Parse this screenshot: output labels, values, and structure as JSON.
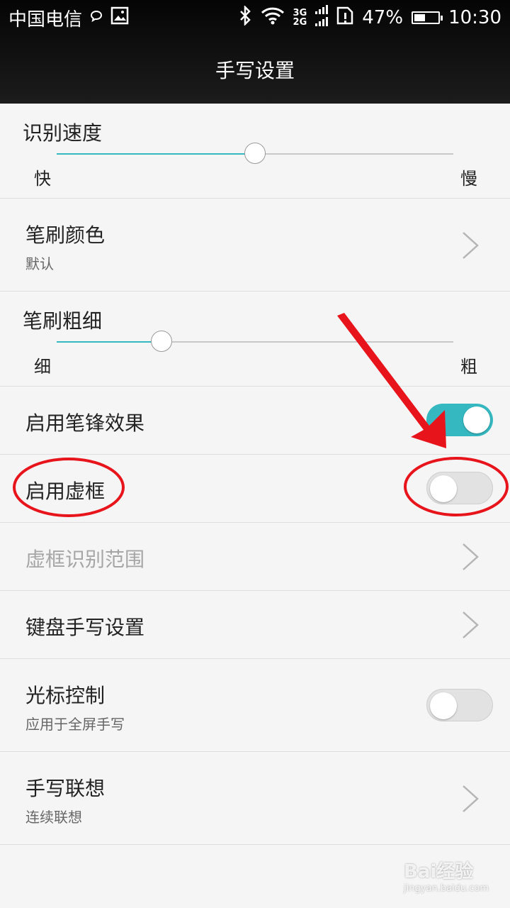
{
  "status_bar": {
    "carrier": "中国电信",
    "net_top": "3G",
    "net_bottom": "2G",
    "battery": "47%",
    "battery_level": 0.47,
    "time": "10:30"
  },
  "header": {
    "title": "手写设置"
  },
  "settings": {
    "recognition_speed": {
      "label": "识别速度",
      "min_label": "快",
      "max_label": "慢",
      "value": 0.5
    },
    "brush_color": {
      "label": "笔刷颜色",
      "sub": "默认"
    },
    "brush_thickness": {
      "label": "笔刷粗细",
      "min_label": "细",
      "max_label": "粗",
      "value": 0.265
    },
    "pen_tip_effect": {
      "label": "启用笔锋效果",
      "enabled": true
    },
    "virtual_frame": {
      "label": "启用虚框",
      "enabled": false
    },
    "virtual_frame_range": {
      "label": "虚框识别范围"
    },
    "keyboard_handwriting": {
      "label": "键盘手写设置"
    },
    "cursor_control": {
      "label": "光标控制",
      "sub": "应用于全屏手写",
      "enabled": false
    },
    "handwriting_association": {
      "label": "手写联想",
      "sub": "连续联想"
    }
  },
  "colors": {
    "accent": "#35b8c0",
    "annotation": "#e8141b"
  },
  "watermark": {
    "text": "Bai经验",
    "url": "jingyan.baidu.com"
  }
}
